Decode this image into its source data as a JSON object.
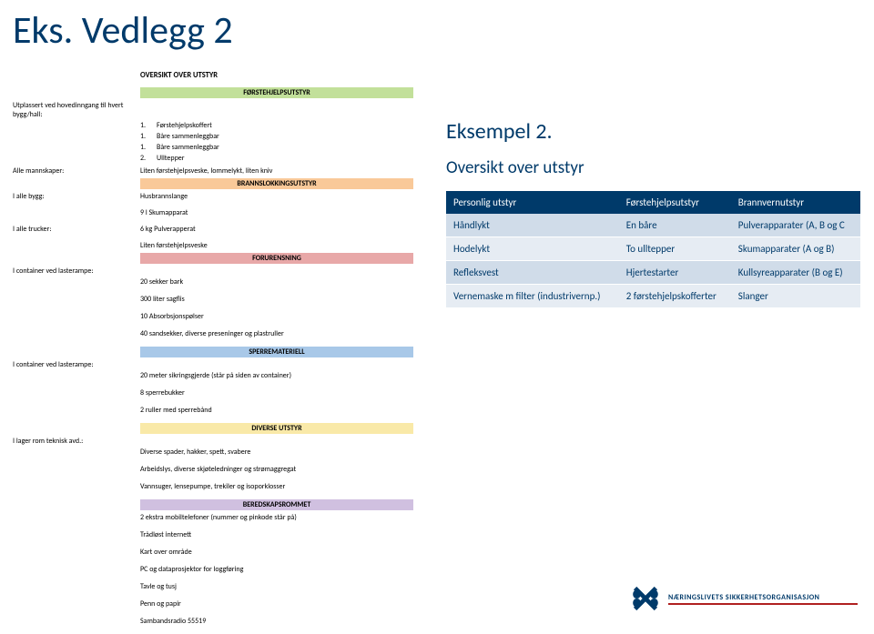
{
  "title": "Eks. Vedlegg 2",
  "left": {
    "h1": "OVERSIKT OVER UTSTYR",
    "s1": {
      "bar": "FØRSTEHJELPSUTSTYR",
      "intro": "Utplassert ved hovedinngang til hvert bygg/hall:",
      "items": [
        {
          "n": "1.",
          "t": "Førstehjelpskoffert"
        },
        {
          "n": "1.",
          "t": "Båre sammenleggbar"
        },
        {
          "n": "1.",
          "t": "Båre sammenleggbar"
        },
        {
          "n": "2.",
          "t": "Ulltepper"
        }
      ],
      "mannskap_l": "Alle mannskaper:",
      "mannskap_v": "Liten førstehjelpsveske, lommelykt, liten kniv"
    },
    "s2": {
      "bar": "BRANNSLOKKINGSUTSTYR",
      "rows": [
        {
          "l": "I alle bygg:",
          "v": "Husbrannslange"
        },
        {
          "l": "",
          "v": "9 l Skumapparat"
        },
        {
          "l": "I alle trucker:",
          "v": "6 kg Pulverapperat"
        },
        {
          "l": "",
          "v": "Liten førstehjelpsveske"
        }
      ]
    },
    "s3": {
      "bar": "FORURENSNING",
      "intro_l": "I container ved lasterampe:",
      "items": [
        "20 sekker bark",
        "300 liter sagflis",
        "10 Absorbsjonspølser",
        "40 sandsekker, diverse preseninger og plastruller"
      ]
    },
    "s4": {
      "bar": "SPERREMATERIELL",
      "intro_l": "I container ved lasterampe:",
      "items": [
        "20 meter sikringsgjerde (står på siden av container)",
        "8 sperrebukker",
        "2 ruller med sperrebånd"
      ]
    },
    "s5": {
      "bar": "DIVERSE UTSTYR",
      "intro_l": "I lager rom teknisk avd.:",
      "items": [
        "Diverse spader, hakker, spett, svabere",
        "Arbeidslys, diverse skjøteledninger og strømaggregat",
        "Vannsuger, lensepumpe, trekiler og isoporklosser"
      ]
    },
    "s6": {
      "bar": "BEREDSKAPSROMMET",
      "items": [
        "2 ekstra mobiltelefoner (nummer og pinkode står på)",
        "Trådløst internett",
        "Kart over område",
        "PC og dataprosjektor for loggføring",
        "Tavle og tusj",
        "Penn og papir",
        "Sambandsradio 55519"
      ]
    }
  },
  "right": {
    "title": "Eksempel 2.",
    "sub": "Oversikt over utstyr",
    "headers": [
      "Personlig utstyr",
      "Førstehjelpsutstyr",
      "Brannvernutstyr"
    ],
    "rows": [
      [
        "Håndlykt",
        "En båre",
        "Pulverapparater (A, B og C"
      ],
      [
        "Hodelykt",
        "To ulltepper",
        "Skumapparater (A og B)"
      ],
      [
        "Refleksvest",
        "Hjertestarter",
        "Kullsyreapparater (B og E)"
      ],
      [
        "Vernemaske m filter (industrivernp.)",
        "2 førstehjelpskofferter",
        "Slanger"
      ]
    ]
  },
  "logo_text": "NÆRINGSLIVETS SIKKERHETSORGANISASJON"
}
